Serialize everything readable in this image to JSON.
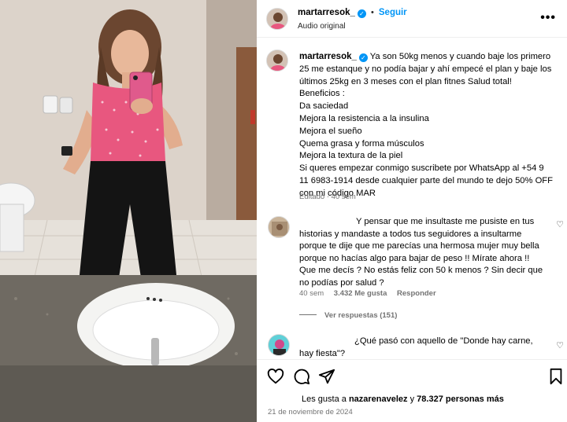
{
  "post": {
    "username": "martarresok_",
    "follow_label": "Seguir",
    "audio_label": "Audio original",
    "more_label": "•••"
  },
  "caption": {
    "username": "martarresok_",
    "lines": [
      "Ya son 50kg menos y cuando baje los primero",
      "25 me estanque y no podía bajar y ahí empecé el plan y baje los",
      "últimos 25kg en 3 meses con el plan fitnes Salud total!",
      "Beneficios :",
      "Da saciedad",
      "Mejora la resistencia a la insulina",
      "Mejora el sueño",
      "Quema grasa y forma músculos",
      "Mejora la textura de la piel",
      "Si queres empezar conmigo suscribete por WhatsApp al +54 9",
      "11 6983-1914 desde cualquier parte del mundo te dejo 50% OFF",
      "con mi código MAR"
    ],
    "meta": "Editado · 40 sem"
  },
  "comments": [
    {
      "lines": [
        "Y pensar que me insultaste me pusiste en tus",
        "historias y mandaste a todos tus seguidores a insultarme",
        "porque te dije que me parecías una hermosa mujer muy bella",
        "porque no hacías algo para bajar de peso !! Mírate ahora !!",
        "Que me decís ? No estás feliz con 50 k menos ? Sin decir que",
        "no podías por salud ?"
      ],
      "age": "40 sem",
      "likes": "3.432 Me gusta",
      "reply": "Responder",
      "view_replies": "Ver respuestas (151)"
    },
    {
      "lines": [
        "¿Qué pasó con aquello de \"Donde hay carne,",
        "hay fiesta\"?"
      ]
    }
  ],
  "footer": {
    "likes_prefix": "Les gusta a ",
    "likes_user": "nazarenavelez",
    "likes_mid": " y ",
    "likes_count": "78.327 personas más",
    "date": "21 de noviembre de 2024"
  },
  "colors": {
    "accent": "#0095f6",
    "muted": "#737373",
    "top_pink": "#e8577f"
  },
  "icons": {
    "like": "heart-icon",
    "comment": "comment-icon",
    "share": "paper-plane-icon",
    "save": "bookmark-icon",
    "more": "more-icon",
    "verified": "verified-badge-icon"
  }
}
